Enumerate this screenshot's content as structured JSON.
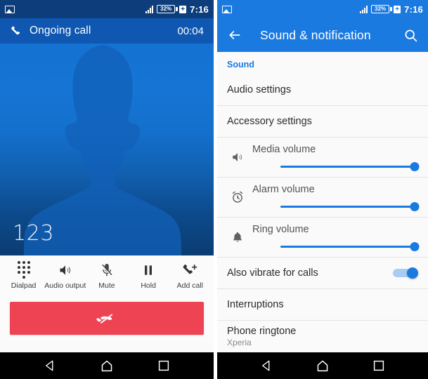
{
  "call_screen": {
    "status_bar": {
      "photo_icon": "photo-icon",
      "signal_icon": "signal-bars-icon",
      "battery_percent": "32%",
      "battery_charging_icon": "battery-charging-icon",
      "time": "7:16"
    },
    "header": {
      "phone_icon": "phone-handset-icon",
      "title": "Ongoing call",
      "timer": "00:04"
    },
    "avatar": {
      "silhouette_icon": "contact-silhouette-icon",
      "number": "123"
    },
    "actions": [
      {
        "label": "Dialpad",
        "icon": "dialpad-icon"
      },
      {
        "label": "Audio output",
        "icon": "speaker-icon"
      },
      {
        "label": "Mute",
        "icon": "microphone-muted-icon"
      },
      {
        "label": "Hold",
        "icon": "pause-icon"
      },
      {
        "label": "Add call",
        "icon": "add-call-icon"
      }
    ],
    "end_call": {
      "icon": "end-call-icon",
      "color": "#ee4353"
    },
    "nav_bar": {
      "back": "back-triangle-icon",
      "home": "home-icon",
      "recents": "recents-square-icon"
    }
  },
  "settings_screen": {
    "status_bar": {
      "photo_icon": "photo-icon",
      "signal_icon": "signal-bars-icon",
      "battery_percent": "32%",
      "battery_charging_icon": "battery-charging-icon",
      "time": "7:16"
    },
    "header": {
      "back_icon": "back-arrow-icon",
      "title": "Sound & notification",
      "search_icon": "search-icon",
      "color": "#1b7ae0"
    },
    "section_label": "Sound",
    "items_top": [
      {
        "label": "Audio settings"
      },
      {
        "label": "Accessory settings"
      }
    ],
    "volumes": [
      {
        "label": "Media volume",
        "icon": "speaker-icon",
        "value": 100
      },
      {
        "label": "Alarm volume",
        "icon": "alarm-clock-icon",
        "value": 100
      },
      {
        "label": "Ring volume",
        "icon": "bell-icon",
        "value": 100
      }
    ],
    "vibrate_row": {
      "label": "Also vibrate for calls",
      "toggle_on": true
    },
    "items_bottom": [
      {
        "label": "Interruptions",
        "sub": ""
      },
      {
        "label": "Phone ringtone",
        "sub": "Xperia"
      }
    ],
    "nav_bar": {
      "back": "back-triangle-icon",
      "home": "home-icon",
      "recents": "recents-square-icon"
    }
  }
}
